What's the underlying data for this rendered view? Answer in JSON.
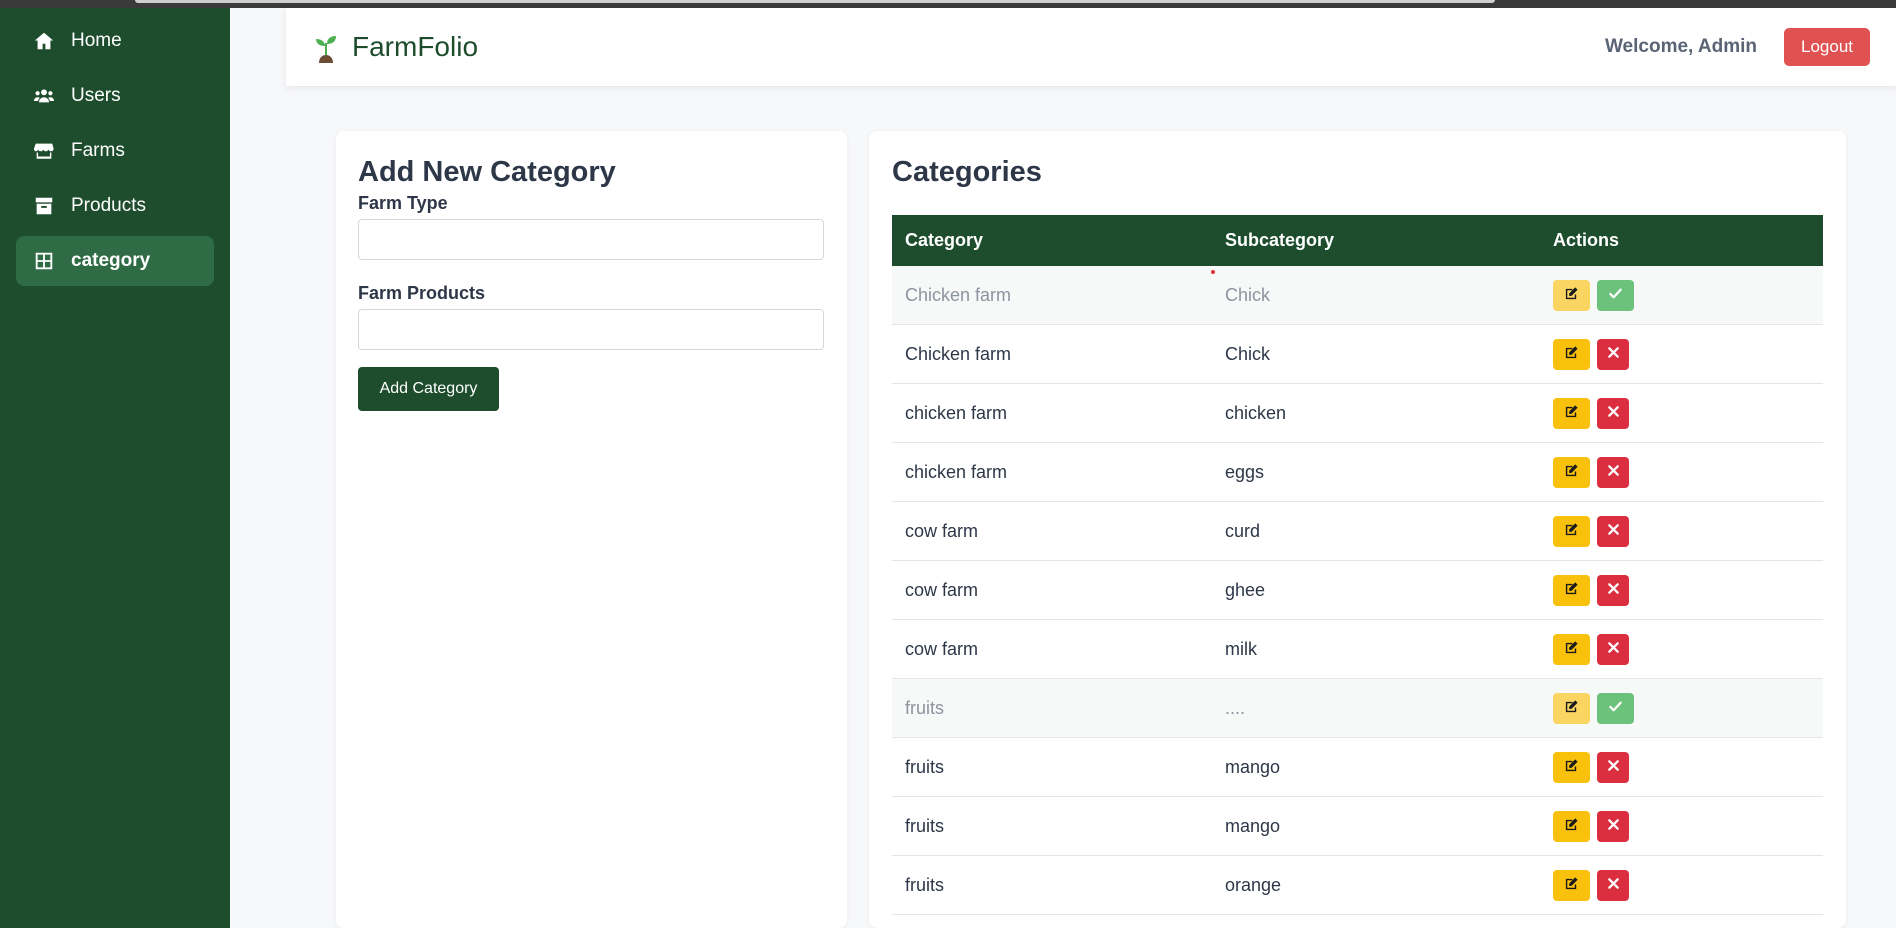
{
  "sidebar": {
    "items": [
      {
        "label": "Home",
        "icon": "home-icon"
      },
      {
        "label": "Users",
        "icon": "users-icon"
      },
      {
        "label": "Farms",
        "icon": "store-icon"
      },
      {
        "label": "Products",
        "icon": "box-icon"
      },
      {
        "label": "category",
        "icon": "grid-icon",
        "active": true
      }
    ]
  },
  "header": {
    "app_name": "FarmFolio",
    "logo_icon": "seedling-icon",
    "welcome": "Welcome, Admin",
    "logout_label": "Logout"
  },
  "form": {
    "title": "Add New Category",
    "farm_type_label": "Farm Type",
    "farm_type_value": "",
    "farm_products_label": "Farm Products",
    "farm_products_value": "",
    "submit_label": "Add Category"
  },
  "categories": {
    "title": "Categories",
    "columns": [
      "Category",
      "Subcategory",
      "Actions"
    ],
    "rows": [
      {
        "category": "Chicken farm",
        "subcategory": "Chick",
        "status": "pending"
      },
      {
        "category": "Chicken farm",
        "subcategory": "Chick",
        "status": "approved"
      },
      {
        "category": "chicken farm",
        "subcategory": "chicken",
        "status": "approved"
      },
      {
        "category": "chicken farm",
        "subcategory": "eggs",
        "status": "approved"
      },
      {
        "category": "cow farm",
        "subcategory": "curd",
        "status": "approved"
      },
      {
        "category": "cow farm",
        "subcategory": "ghee",
        "status": "approved"
      },
      {
        "category": "cow farm",
        "subcategory": "milk",
        "status": "approved"
      },
      {
        "category": "fruits",
        "subcategory": "....",
        "status": "pending"
      },
      {
        "category": "fruits",
        "subcategory": "mango",
        "status": "approved"
      },
      {
        "category": "fruits",
        "subcategory": "mango",
        "status": "approved"
      },
      {
        "category": "fruits",
        "subcategory": "orange",
        "status": "approved"
      }
    ]
  },
  "colors": {
    "primary": "#1d4d2c",
    "sidebar_active": "#2f6b45",
    "logout": "#e05252",
    "edit": "#f9c10b",
    "delete": "#db2f3f",
    "approve": "#5fba6e"
  }
}
